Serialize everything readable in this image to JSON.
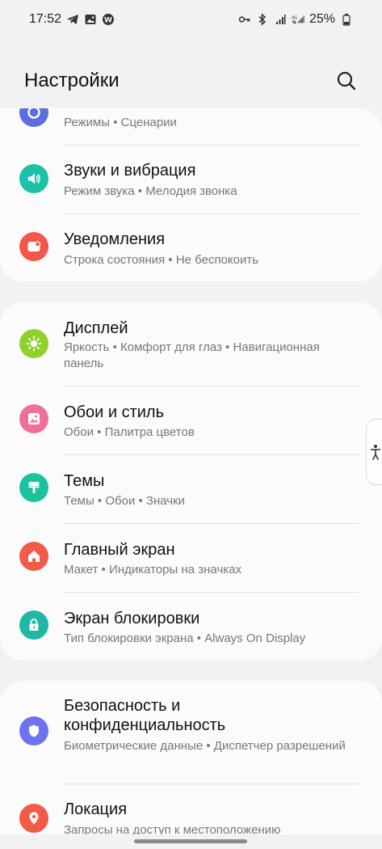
{
  "status_bar": {
    "time": "17:52",
    "battery": "25%"
  },
  "header": {
    "title": "Настройки"
  },
  "groups": [
    {
      "items": [
        {
          "title": "",
          "sub": "Режимы  •  Сценарии",
          "icon": "modes-icon",
          "color": "#5b6ee1"
        },
        {
          "title": "Звуки и вибрация",
          "sub": "Режим звука  •  Мелодия звонка",
          "icon": "volume-icon",
          "color": "#1bc2a7"
        },
        {
          "title": "Уведомления",
          "sub": "Строка состояния  •  Не беспокоить",
          "icon": "notification-icon",
          "color": "#f2574b"
        }
      ]
    },
    {
      "items": [
        {
          "title": "Дисплей",
          "sub": "Яркость  •  Комфорт для глаз  •  Навигационная панель",
          "icon": "brightness-icon",
          "color": "#8fd02d"
        },
        {
          "title": "Обои и стиль",
          "sub": "Обои  •  Палитра цветов",
          "icon": "wallpaper-icon",
          "color": "#f06f9a"
        },
        {
          "title": "Темы",
          "sub": "Темы  •  Обои  •  Значки",
          "icon": "themes-icon",
          "color": "#19c3a0"
        },
        {
          "title": "Главный экран",
          "sub": "Макет  •  Индикаторы на значках",
          "icon": "home-icon",
          "color": "#f25b46"
        },
        {
          "title": "Экран блокировки",
          "sub": "Тип блокировки экрана  •  Always On Display",
          "icon": "lock-icon",
          "color": "#1fb7a5"
        }
      ]
    },
    {
      "items": [
        {
          "title": "Безопасность и конфиденциальность",
          "sub": "Биометрические данные  •  Диспетчер разрешений",
          "icon": "shield-icon",
          "color": "#6d73f0"
        },
        {
          "title": "Локация",
          "sub": "Запросы на доступ к местоположению",
          "icon": "location-icon",
          "color": "#f25b46"
        }
      ]
    }
  ]
}
